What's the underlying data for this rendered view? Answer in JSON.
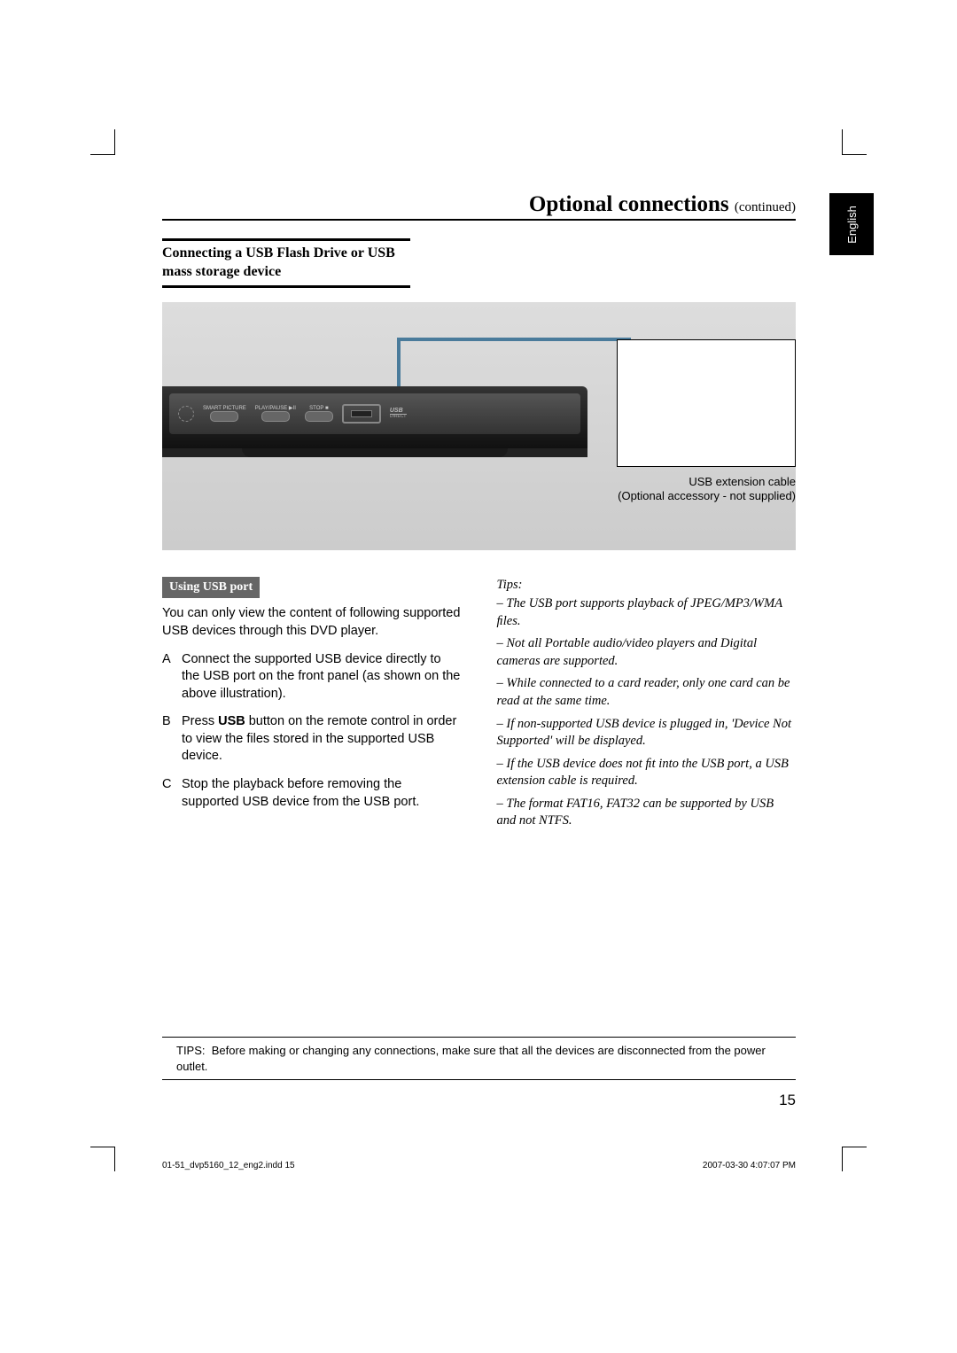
{
  "chapter_title_main": "Optional connections ",
  "chapter_title_sub": "(continued)",
  "language_tab": "English",
  "section_heading": "Connecting a USB Flash Drive or USB mass storage device",
  "device_labels": {
    "smart": "SMART PICTURE",
    "play": "PLAY/PAUSE ▶II",
    "stop": "STOP ■",
    "usb_logo": "USB",
    "usb_logo_sub": "DIRECT"
  },
  "callout": {
    "line1": "USB extension cable",
    "line2": "(Optional accessory - not supplied)"
  },
  "using_usb_heading": "Using USB port",
  "intro_para": "You can only view the content of following supported USB devices through this DVD player.",
  "steps": [
    {
      "letter": "A",
      "text": "Connect the supported USB device directly to the USB port on the front panel (as shown on the above illustration)."
    },
    {
      "letter": "B",
      "text_pre": "Press ",
      "bold": "USB",
      "text_post": " button on the remote control in order to view the ﬁles stored in the supported USB device."
    },
    {
      "letter": "C",
      "text": "Stop the playback before removing the supported USB device from the USB port."
    }
  ],
  "tips_label": "Tips:",
  "tips": [
    "– The USB port supports playback of JPEG/MP3/WMA ﬁles.",
    "– Not all Portable audio/video players and Digital cameras are supported.",
    "– While connected to a card reader, only one card can be read at the same time.",
    "– If non-supported USB device is plugged in, 'Device Not Supported' will be displayed.",
    "– If the USB device does not ﬁt into the USB port, a USB extension cable is required.",
    "– The format FAT16, FAT32 can be supported by USB and not NTFS."
  ],
  "bottom_tip_label": "TIPS:",
  "bottom_tip_text": "Before making or changing any connections, make sure that all the devices are disconnected from the power outlet.",
  "page_number": "15",
  "footer_left": "01-51_dvp5160_12_eng2.indd   15",
  "footer_right": "2007-03-30   4:07:07 PM"
}
